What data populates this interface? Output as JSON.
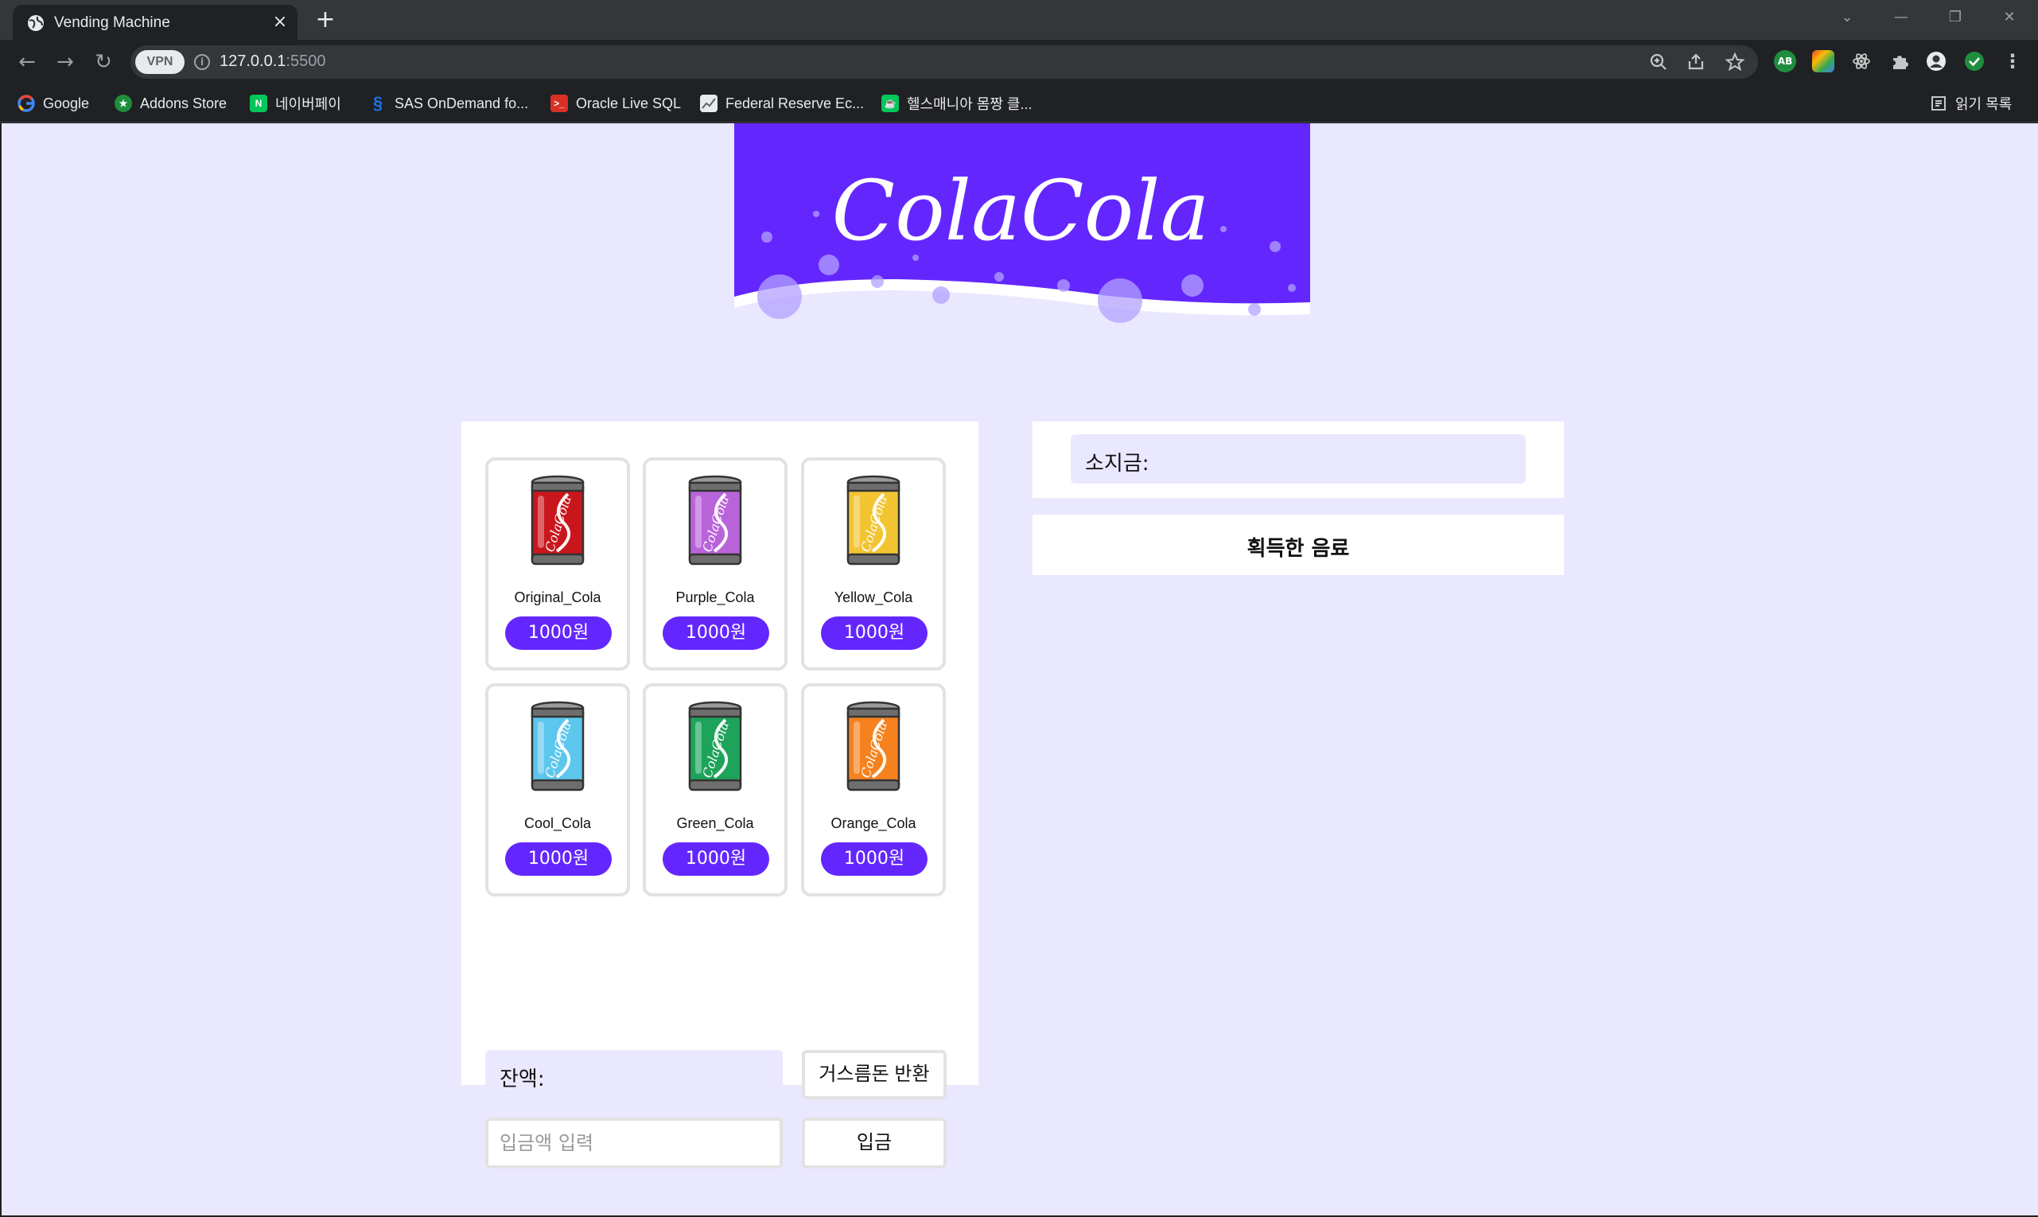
{
  "browser": {
    "tab_title": "Vending Machine",
    "tab_close": "×",
    "new_tab": "+",
    "url_host": "127.0.0.1",
    "url_port": ":5500",
    "vpn_label": "VPN",
    "window_controls": [
      "⌄",
      "—",
      "❐",
      "✕"
    ]
  },
  "bookmarks": [
    {
      "label": "Google",
      "icon": "google-icon",
      "color": "#4285f4"
    },
    {
      "label": "Addons Store",
      "icon": "addons-store-icon",
      "color": "#1e8e3e"
    },
    {
      "label": "네이버페이",
      "icon": "naverpay-icon",
      "color": "#03c75a"
    },
    {
      "label": "SAS OnDemand fo...",
      "icon": "sas-icon",
      "color": "#1a73e8"
    },
    {
      "label": "Oracle Live SQL",
      "icon": "oracle-icon",
      "color": "#d93025"
    },
    {
      "label": "Federal Reserve Ec...",
      "icon": "chart-icon",
      "color": "#9aa0a6"
    },
    {
      "label": "헬스매니아 몸짱 클...",
      "icon": "cafe-icon",
      "color": "#03c75a"
    }
  ],
  "reading_list": "읽기 목록",
  "banner": {
    "brand": "ColaCola",
    "bg_color": "#6327fe"
  },
  "machine": {
    "items": [
      {
        "name": "Original_Cola",
        "price": "1000원",
        "color": "#c9161c"
      },
      {
        "name": "Purple_Cola",
        "price": "1000원",
        "color": "#b963d9"
      },
      {
        "name": "Yellow_Cola",
        "price": "1000원",
        "color": "#f2c432"
      },
      {
        "name": "Cool_Cola",
        "price": "1000원",
        "color": "#5cc6ec"
      },
      {
        "name": "Green_Cola",
        "price": "1000원",
        "color": "#1ea35a"
      },
      {
        "name": "Orange_Cola",
        "price": "1000원",
        "color": "#f5821f"
      }
    ],
    "balance_label": "잔액:",
    "return_change_label": "거스름돈 반환",
    "deposit_placeholder": "입금액 입력",
    "deposit_label": "입금"
  },
  "wallet": {
    "label": "소지금:"
  },
  "acquired": {
    "title": "획득한 음료"
  },
  "colors": {
    "accent": "#6327fe",
    "page_bg": "#eae8fe"
  }
}
